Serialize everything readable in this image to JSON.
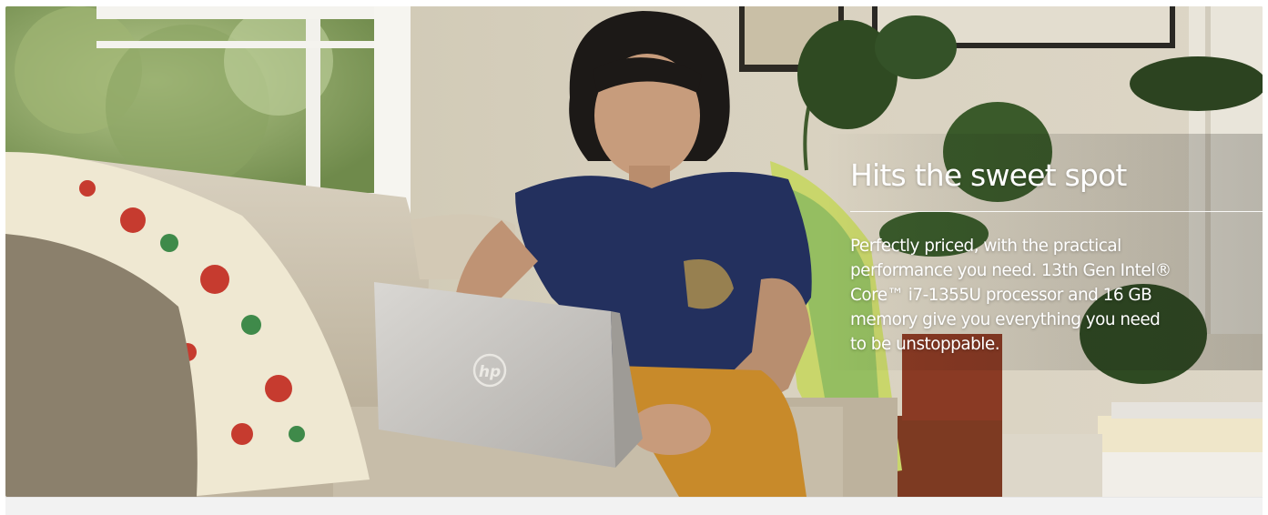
{
  "hero": {
    "headline": "Hits the sweet spot",
    "body_lines": [
      "Perfectly priced, with the practical",
      "performance you need. 13th Gen Intel®",
      "Core™ i7-1355U processor and 16 GB",
      "memory give you everything you need",
      "to be unstoppable."
    ],
    "laptop_logo_text": "hp",
    "text_color": "#ffffff",
    "scene": "man-using-laptop-on-sofa"
  }
}
